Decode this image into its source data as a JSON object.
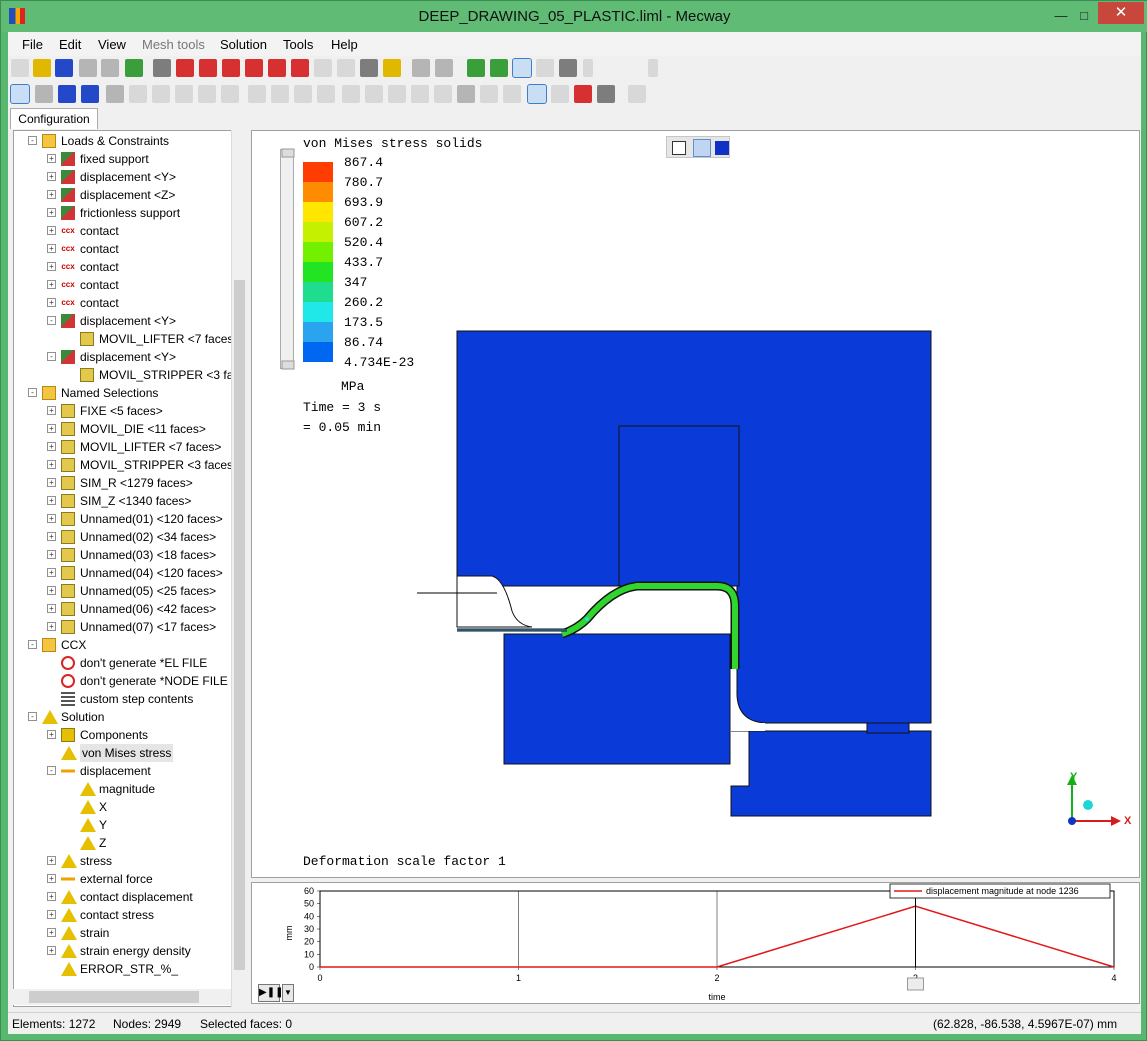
{
  "window": {
    "title": "DEEP_DRAWING_05_PLASTIC.liml - Mecway",
    "controls": {
      "minimize": "—",
      "maximize": "□",
      "close": "✕"
    }
  },
  "menu": [
    "File",
    "Edit",
    "View",
    "Mesh tools",
    "Solution",
    "Tools",
    "Help"
  ],
  "tabs": {
    "configuration": "Configuration"
  },
  "tree": [
    {
      "label": "Loads & Constraints",
      "icon": "folder-icon",
      "level": 1,
      "exp": "-"
    },
    {
      "label": "fixed support",
      "icon": "fixed-support-icon",
      "level": 2,
      "exp": "+"
    },
    {
      "label": "displacement <Y>",
      "icon": "displacement-icon",
      "level": 2,
      "exp": "+"
    },
    {
      "label": "displacement <Z>",
      "icon": "displacement-icon",
      "level": 2,
      "exp": "+"
    },
    {
      "label": "frictionless support",
      "icon": "frictionless-support-icon",
      "level": 2,
      "exp": "+"
    },
    {
      "label": "contact",
      "icon": "ccx-contact-icon",
      "level": 2,
      "exp": "+"
    },
    {
      "label": "contact",
      "icon": "ccx-contact-icon",
      "level": 2,
      "exp": "+"
    },
    {
      "label": "contact",
      "icon": "ccx-contact-icon",
      "level": 2,
      "exp": "+"
    },
    {
      "label": "contact",
      "icon": "ccx-contact-icon",
      "level": 2,
      "exp": "+"
    },
    {
      "label": "contact",
      "icon": "ccx-contact-icon",
      "level": 2,
      "exp": "+"
    },
    {
      "label": "displacement <Y>",
      "icon": "displacement-icon",
      "level": 2,
      "exp": "-"
    },
    {
      "label": "MOVIL_LIFTER <7 faces>",
      "icon": "named-selection-icon",
      "level": 3,
      "exp": ""
    },
    {
      "label": "displacement <Y>",
      "icon": "displacement-icon",
      "level": 2,
      "exp": "-"
    },
    {
      "label": "MOVIL_STRIPPER <3 faces>",
      "icon": "named-selection-icon",
      "level": 3,
      "exp": ""
    },
    {
      "label": "Named Selections",
      "icon": "folder-icon",
      "level": 1,
      "exp": "-"
    },
    {
      "label": "FIXE <5 faces>",
      "icon": "named-selection-icon",
      "level": 2,
      "exp": "+"
    },
    {
      "label": "MOVIL_DIE <11 faces>",
      "icon": "named-selection-icon",
      "level": 2,
      "exp": "+"
    },
    {
      "label": "MOVIL_LIFTER <7 faces>",
      "icon": "named-selection-icon",
      "level": 2,
      "exp": "+"
    },
    {
      "label": "MOVIL_STRIPPER <3 faces>",
      "icon": "named-selection-icon",
      "level": 2,
      "exp": "+"
    },
    {
      "label": "SIM_R <1279 faces>",
      "icon": "named-selection-icon",
      "level": 2,
      "exp": "+"
    },
    {
      "label": "SIM_Z <1340 faces>",
      "icon": "named-selection-icon",
      "level": 2,
      "exp": "+"
    },
    {
      "label": "Unnamed(01) <120 faces>",
      "icon": "named-selection-icon",
      "level": 2,
      "exp": "+"
    },
    {
      "label": "Unnamed(02) <34 faces>",
      "icon": "named-selection-icon",
      "level": 2,
      "exp": "+"
    },
    {
      "label": "Unnamed(03) <18 faces>",
      "icon": "named-selection-icon",
      "level": 2,
      "exp": "+"
    },
    {
      "label": "Unnamed(04) <120 faces>",
      "icon": "named-selection-icon",
      "level": 2,
      "exp": "+"
    },
    {
      "label": "Unnamed(05) <25 faces>",
      "icon": "named-selection-icon",
      "level": 2,
      "exp": "+"
    },
    {
      "label": "Unnamed(06) <42 faces>",
      "icon": "named-selection-icon",
      "level": 2,
      "exp": "+"
    },
    {
      "label": "Unnamed(07) <17 faces>",
      "icon": "named-selection-icon",
      "level": 2,
      "exp": "+"
    },
    {
      "label": "CCX",
      "icon": "ccx-folder-icon",
      "level": 1,
      "exp": "-"
    },
    {
      "label": "don't generate *EL FILE",
      "icon": "forbidden-icon",
      "level": 2,
      "exp": ""
    },
    {
      "label": "don't generate *NODE FILE",
      "icon": "forbidden-icon",
      "level": 2,
      "exp": ""
    },
    {
      "label": "custom step contents",
      "icon": "ccx-lines-icon",
      "level": 2,
      "exp": ""
    },
    {
      "label": "Solution",
      "icon": "solution-icon",
      "level": 1,
      "exp": "-"
    },
    {
      "label": "Components",
      "icon": "components-icon",
      "level": 2,
      "exp": "+"
    },
    {
      "label": "von Mises stress",
      "icon": "result-icon",
      "level": 2,
      "exp": "",
      "selected": true
    },
    {
      "label": "displacement",
      "icon": "external-force-icon",
      "level": 2,
      "exp": "-"
    },
    {
      "label": "magnitude",
      "icon": "result-icon",
      "level": 3,
      "exp": ""
    },
    {
      "label": "X",
      "icon": "result-icon",
      "level": 3,
      "exp": ""
    },
    {
      "label": "Y",
      "icon": "result-icon",
      "level": 3,
      "exp": ""
    },
    {
      "label": "Z",
      "icon": "result-icon",
      "level": 3,
      "exp": ""
    },
    {
      "label": "stress",
      "icon": "result-icon",
      "level": 2,
      "exp": "+"
    },
    {
      "label": "external force",
      "icon": "external-force-icon",
      "level": 2,
      "exp": "+"
    },
    {
      "label": "contact displacement",
      "icon": "result-icon",
      "level": 2,
      "exp": "+"
    },
    {
      "label": "contact stress",
      "icon": "result-icon",
      "level": 2,
      "exp": "+"
    },
    {
      "label": "strain",
      "icon": "result-icon",
      "level": 2,
      "exp": "+"
    },
    {
      "label": "strain energy density",
      "icon": "result-icon",
      "level": 2,
      "exp": "+"
    },
    {
      "label": "ERROR_STR_%_",
      "icon": "result-icon",
      "level": 2,
      "exp": ""
    }
  ],
  "viewport": {
    "title": "von Mises stress solids",
    "legend_values": [
      "867.4",
      "780.7",
      "693.9",
      "607.2",
      "520.4",
      "433.7",
      "347",
      "260.2",
      "173.5",
      "86.74",
      "4.734E-23"
    ],
    "legend_colors": [
      "#ff3d00",
      "#ff8c00",
      "#ffe600",
      "#c5f000",
      "#73ef00",
      "#23e423",
      "#20dc8f",
      "#21e8e8",
      "#2aa4ee",
      "#0068f0",
      "#0a3ad8"
    ],
    "unit": "MPa",
    "time_line1": "Time = 3 s",
    "time_line2": "= 0.05 min",
    "deformation": "Deformation scale factor 1",
    "axis_y": "Y",
    "axis_x": "X"
  },
  "chart_data": {
    "type": "line",
    "series": [
      {
        "name": "displacement magnitude at node 1236",
        "x": [
          0,
          2,
          3,
          4
        ],
        "y": [
          0,
          0,
          48,
          0
        ]
      }
    ],
    "xlabel": "time",
    "ylabel": "mm",
    "xlim": [
      0,
      4
    ],
    "ylim": [
      0,
      60
    ],
    "xticks": [
      "0",
      "1",
      "2",
      "3",
      "4"
    ],
    "yticks": [
      "0",
      "10",
      "20",
      "30",
      "40",
      "50",
      "60"
    ],
    "current_time": 3,
    "legend_position": "top-right"
  },
  "status": {
    "elements": "Elements: 1272",
    "nodes": "Nodes: 2949",
    "selected": "Selected faces: 0",
    "coords": "(62.828, -86.538, 4.5967E-07) mm"
  }
}
